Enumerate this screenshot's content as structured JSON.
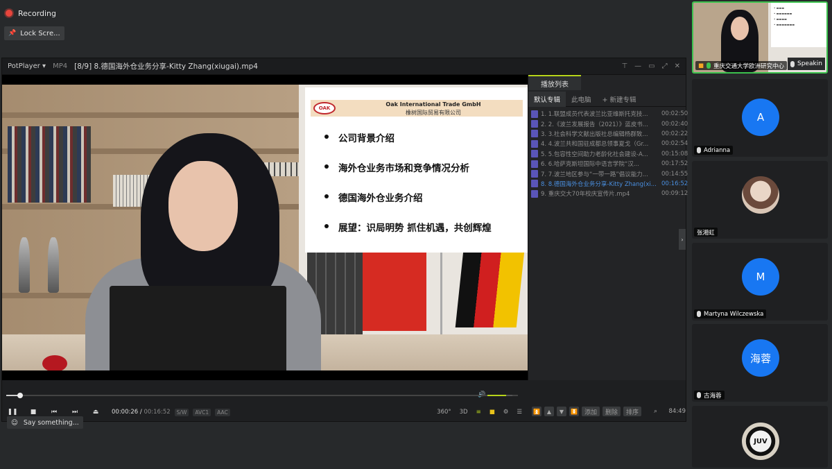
{
  "meeting": {
    "recording_label": "Recording",
    "lock_label": "Lock Scre...",
    "say_placeholder": "Say something...",
    "speaking_label": "Speakin",
    "record_color": "#e8453c"
  },
  "player": {
    "brand": "PotPlayer",
    "format": "MP4",
    "file_title": "[8/9] 8.德国海外仓业务分享-Kitty Zhang(xiugai).mp4",
    "current_time": "00:00:26",
    "total_time": "00:16:52",
    "tags": [
      "S/W",
      "AVC1",
      "AAC"
    ],
    "right_controls": [
      "360°",
      "3D",
      "≡",
      "■",
      "⚙",
      "☰"
    ],
    "seek_fraction": 0.027,
    "volume_fraction": 0.75,
    "accent": "#b7d41a"
  },
  "slide": {
    "logo_text": "OAK",
    "company_en": "Oak International Trade GmbH",
    "company_cn": "橡树国际贸易有限公司",
    "bullets": [
      "公司背景介绍",
      "海外仓业务市场和竞争情况分析",
      "德国海外仓业务介绍",
      "展望：识局明势  抓住机遇，共创辉煌"
    ]
  },
  "playlist": {
    "tab": "播放列表",
    "subtabs": [
      "默认专辑",
      "此电脑",
      "+ 新建专辑"
    ],
    "items": [
      {
        "name": "1. 1.联盟成员代表波兰比亚维斯托克技...",
        "dur": "00:02:50"
      },
      {
        "name": "2. 2.《波兰发展报告（2021）》蓝皮书...",
        "dur": "00:02:40"
      },
      {
        "name": "3. 3.社会科学文献出版社总编辑杨群致...",
        "dur": "00:02:22"
      },
      {
        "name": "4. 4.波兰共和国驻成都总领事夏戈（Gr...",
        "dur": "00:02:54"
      },
      {
        "name": "5. 5.包容性空间助力老龄化社会建设-A...",
        "dur": "00:15:08"
      },
      {
        "name": "6. 6.哈萨克斯坦国际中语言学院“汉...",
        "dur": "00:17:52"
      },
      {
        "name": "7. 7.波兰地区参与“一带一路”倡议能力...",
        "dur": "00:14:55"
      },
      {
        "name": "8. 8.德国海外仓业务分享-Kitty Zhang(xi...",
        "dur": "00:16:52",
        "playing": true
      },
      {
        "name": "9. 重庆交大70年校庆宣传片.mp4",
        "dur": "00:09:12"
      }
    ],
    "controls": [
      "添加",
      "删除",
      "排序"
    ],
    "time": "84:49"
  },
  "participants": [
    {
      "name": "重庆交通大学欧洲研究中心",
      "type": "camera"
    },
    {
      "name": "Adrianna",
      "initial": "A",
      "type": "initial"
    },
    {
      "name": "张湘虹",
      "type": "photo"
    },
    {
      "name": "Martyna Wilczewska",
      "initial": "M",
      "type": "initial"
    },
    {
      "name": "古海蓉",
      "initial": "海蓉",
      "type": "initial"
    },
    {
      "name": "",
      "initial": "JUV",
      "type": "juve"
    }
  ]
}
